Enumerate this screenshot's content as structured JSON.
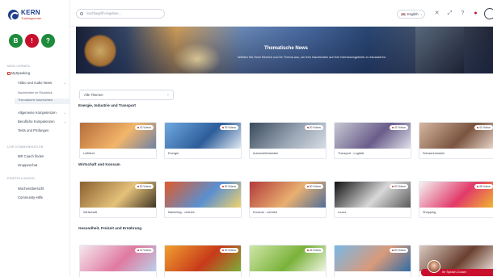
{
  "brand": {
    "name": "KERN",
    "sub": "Trainingcenter"
  },
  "apps": [
    {
      "letter": "B",
      "color": "#1e8a3b"
    },
    {
      "letter": "!",
      "color": "#c8102e"
    },
    {
      "letter": "?",
      "color": "#1e8a3b"
    }
  ],
  "sidebar": {
    "section_1": "Mein Lernen",
    "my_speaking": "MySpeaking",
    "item_1": "Video und Audio News",
    "sub_1": "Nachrichten im Rückblick",
    "sub_2": "Thematische Nachrichten",
    "item_2": "Allgemeine Kompetenzen",
    "item_3": "Berufliche Kompetenzen",
    "item_4": "Tests und Prüfungen",
    "section_2": "Live Kommunikation",
    "item_5": "MR Coach finden",
    "item_6": "Gruppenchat",
    "section_3": "Einstellungen",
    "item_7": "Wochenübersicht",
    "item_8": "Community-Hilfe"
  },
  "topbar": {
    "search_placeholder": "Suchbegriff eingeben...",
    "language": "English",
    "icons": [
      "refresh-icon",
      "expand-icon",
      "help-icon",
      "notification-icon",
      "user-icon"
    ]
  },
  "banner": {
    "title": "Thematische News",
    "subtitle": "Wählen Sie Ihren Bereich und Ihr Thema aus, um Ihre Nachrichten auf Ihre Interessengebiete zu fokussieren."
  },
  "filter": {
    "value": "Alle Themen"
  },
  "categories": [
    {
      "title": "Energie, Industrie und Transport",
      "cards": [
        {
          "label": "Luftfahrt",
          "badge": "42 Videos",
          "colors": [
            "#b56c3a",
            "#f2b56a",
            "#6a7ea6"
          ]
        },
        {
          "label": "Energie",
          "badge": "50 Videos",
          "colors": [
            "#6fa9e0",
            "#2d5d9a",
            "#e8eef5"
          ]
        },
        {
          "label": "Automobilindustrie",
          "badge": "50 Videos",
          "colors": [
            "#3a4a5c",
            "#9aa6b4",
            "#d8dee6"
          ]
        },
        {
          "label": "Transport - Logistik",
          "badge": "42 Videos",
          "colors": [
            "#c7c9d4",
            "#6a5d8a",
            "#e4e5ee"
          ]
        },
        {
          "label": "Schwerindustrie",
          "badge": "42 Videos",
          "colors": [
            "#d6b7a0",
            "#7a5440",
            "#f0dfd2"
          ]
        }
      ]
    },
    {
      "title": "Wirtschaft und Konsum",
      "cards": [
        {
          "label": "Wirtschaft",
          "badge": "50 Videos",
          "colors": [
            "#8a6030",
            "#e4c27a",
            "#3a3022"
          ]
        },
        {
          "label": "Marketing - vertrieb",
          "badge": "50 Videos",
          "colors": [
            "#e05a2a",
            "#5a8fd0",
            "#f5d56a"
          ]
        },
        {
          "label": "Konsum - vertrieb",
          "badge": "50 Videos",
          "colors": [
            "#b33a3a",
            "#e8b070",
            "#4a6a9a"
          ]
        },
        {
          "label": "Luxus",
          "badge": "50 Videos",
          "colors": [
            "#111111",
            "#d8d8d8",
            "#555555"
          ]
        },
        {
          "label": "Shopping",
          "badge": "48 Videos",
          "colors": [
            "#f4f4f4",
            "#e23a6a",
            "#f2c02a"
          ]
        }
      ]
    },
    {
      "title": "Gesundheit, Freizeit und Ernährung",
      "cards": [
        {
          "label": "",
          "badge": "42 Videos",
          "colors": [
            "#f4e8ee",
            "#e07aa0",
            "#b8d4ec"
          ]
        },
        {
          "label": "",
          "badge": "50 Videos",
          "colors": [
            "#f0a030",
            "#c83a1a",
            "#7ab23a"
          ]
        },
        {
          "label": "",
          "badge": "46 Videos",
          "colors": [
            "#cfe6a8",
            "#7ab23a",
            "#f5f8ea"
          ]
        },
        {
          "label": "",
          "badge": "50 Videos",
          "colors": [
            "#7ab8e6",
            "#d89a7a",
            "#2a6aa8"
          ]
        },
        {
          "label": "",
          "badge": "",
          "colors": [
            "#d9c9c0",
            "#6a4030",
            "#f4ece6"
          ]
        }
      ]
    }
  ],
  "coach": {
    "button_label": "Ihr Sprach-Coach"
  }
}
